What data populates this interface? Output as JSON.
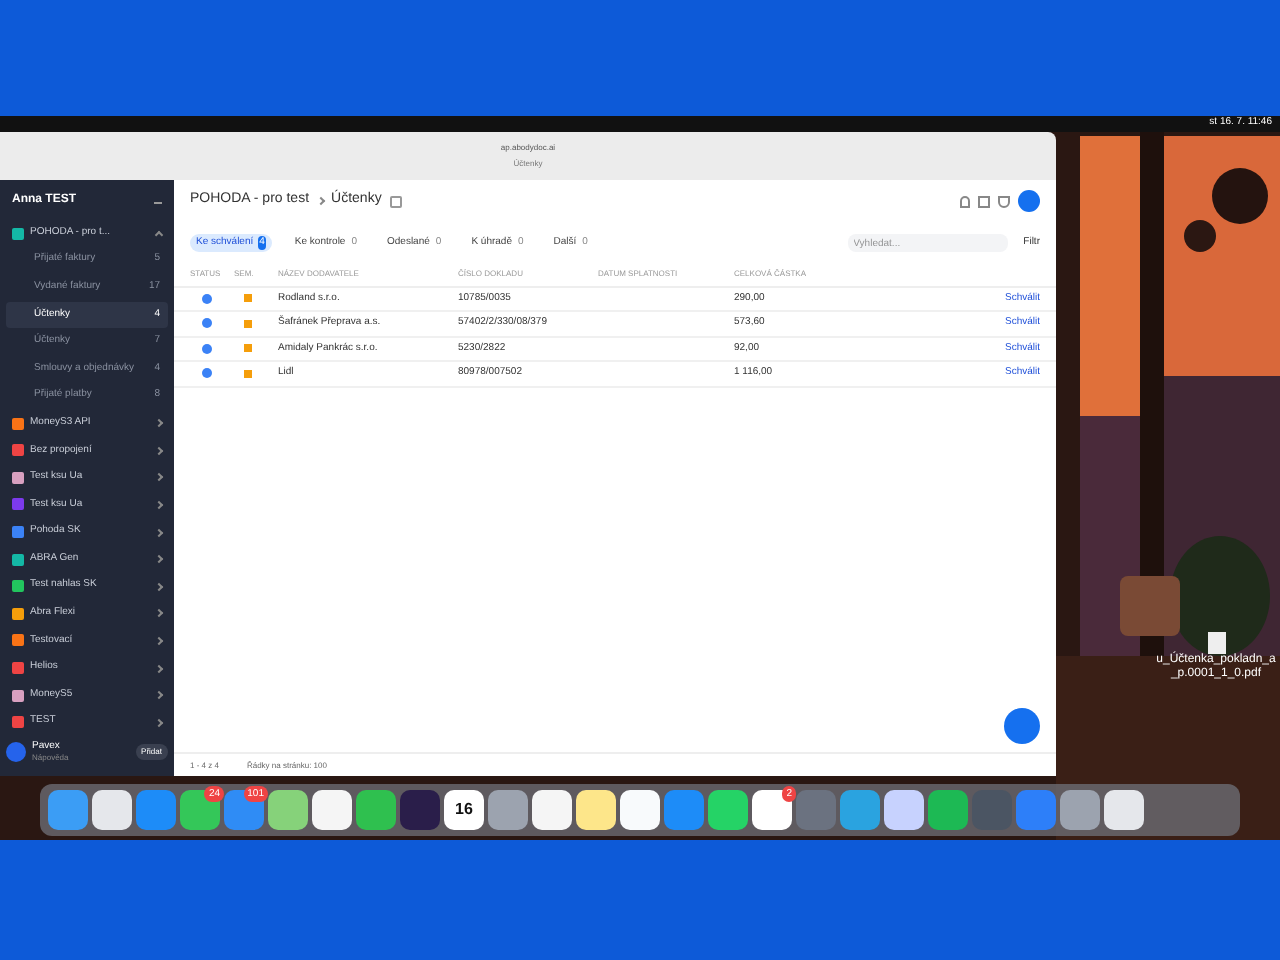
{
  "menu_bar": {
    "clock": "st 16. 7. 11:46"
  },
  "browser": {
    "url": "ap.abodydoc.ai",
    "tab_label": "Účtenky"
  },
  "sidebar": {
    "user": "Anna TEST",
    "companies": [
      {
        "name": "POHODA - pro t...",
        "color": "#14b8a6",
        "expanded": true,
        "children": [
          {
            "label": "Přijaté faktury",
            "count": "5",
            "selected": false
          },
          {
            "label": "Vydané faktury",
            "count": "17",
            "selected": false
          },
          {
            "label": "Účtenky",
            "count": "4",
            "selected": true
          },
          {
            "label": "Účtenky",
            "count": "7",
            "selected": false
          },
          {
            "label": "Smlouvy a objednávky",
            "count": "4",
            "selected": false
          },
          {
            "label": "Přijaté platby",
            "count": "8",
            "selected": false
          }
        ]
      },
      {
        "name": "MoneyS3 API",
        "color": "#f97316",
        "expanded": false
      },
      {
        "name": "Bez propojení",
        "color": "#ef4444",
        "expanded": false
      },
      {
        "name": "Test ksu Ua",
        "color": "#d8a0c0",
        "expanded": false
      },
      {
        "name": "Test ksu Ua",
        "color": "#7c3aed",
        "expanded": false
      },
      {
        "name": "Pohoda SK",
        "color": "#3b82f6",
        "expanded": false
      },
      {
        "name": "ABRA Gen",
        "color": "#14b8a6",
        "expanded": false
      },
      {
        "name": "Test nahlas SK",
        "color": "#22c55e",
        "expanded": false
      },
      {
        "name": "Abra Flexi",
        "color": "#f59e0b",
        "expanded": false
      },
      {
        "name": "Testovací",
        "color": "#f97316",
        "expanded": false
      },
      {
        "name": "Helios",
        "color": "#ef4444",
        "expanded": false
      },
      {
        "name": "MoneyS5",
        "color": "#d8a0c0",
        "expanded": false
      },
      {
        "name": "TEST",
        "color": "#ef4444",
        "expanded": false
      }
    ],
    "footer": {
      "name": "Pavex",
      "subtitle": "Nápověda",
      "add_button": "Přidat"
    }
  },
  "header": {
    "breadcrumb": [
      "POHODA - pro test",
      "Účtenky"
    ]
  },
  "filters": [
    {
      "label": "Ke schválení",
      "count": "4",
      "selected": true
    },
    {
      "label": "Ke kontrole",
      "count": "0",
      "selected": false
    },
    {
      "label": "Odeslané",
      "count": "0",
      "selected": false
    },
    {
      "label": "K úhradě",
      "count": "0",
      "selected": false
    },
    {
      "label": "Další",
      "count": "0",
      "selected": false
    }
  ],
  "search": {
    "placeholder": "Vyhledat..."
  },
  "filter_button": "Filtr",
  "table": {
    "columns": [
      "STATUS",
      "SEM.",
      "NÁZEV DODAVATELE",
      "ČÍSLO DOKLADU",
      "DATUM SPLATNOSTI",
      "CELKOVÁ ČÁSTKA"
    ],
    "rows": [
      {
        "supplier": "Rodland s.r.o.",
        "number": "10785/0035",
        "amount": "290,00",
        "action": "Schválit"
      },
      {
        "supplier": "Šafránek Přeprava a.s.",
        "number": "57402/2/330/08/379",
        "amount": "573,60",
        "action": "Schválit"
      },
      {
        "supplier": "Amidaly Pankrác s.r.o.",
        "number": "5230/2822",
        "amount": "92,00",
        "action": "Schválit"
      },
      {
        "supplier": "Lidl",
        "number": "80978/007502",
        "amount": "1 116,00",
        "action": "Schválit"
      }
    ]
  },
  "pagination": {
    "range": "1 - 4 z 4",
    "rows_per_page": "Řádky na stránku: 100"
  },
  "desktop_file": "u_Účtenka_pokladn_a_p.0001_1_0.pdf",
  "dock": [
    {
      "color": "#3b9df5"
    },
    {
      "color": "#e5e7eb"
    },
    {
      "color": "#1d8cf8"
    },
    {
      "color": "#34c759",
      "badge": "24"
    },
    {
      "color": "#2f8cf5",
      "badge": "101"
    },
    {
      "color": "#86d27a"
    },
    {
      "color": "#f5f5f5"
    },
    {
      "color": "#2fc04f"
    },
    {
      "color": "#2a1e4a"
    },
    {
      "color": "#ffffff",
      "text": "16"
    },
    {
      "color": "#9ca3af"
    },
    {
      "color": "#f5f5f5"
    },
    {
      "color": "#fde68a"
    },
    {
      "color": "#f8fafc"
    },
    {
      "color": "#1d8cf8"
    },
    {
      "color": "#25d366"
    },
    {
      "color": "#ffffff",
      "badge": "2"
    },
    {
      "color": "#6b7280"
    },
    {
      "color": "#2aa3e0"
    },
    {
      "color": "#c7d2fe"
    },
    {
      "color": "#1db954"
    },
    {
      "color": "#4b5563"
    },
    {
      "color": "#2d7ff9"
    },
    {
      "color": "#9ca3af"
    },
    {
      "color": "#e5e7eb"
    }
  ]
}
